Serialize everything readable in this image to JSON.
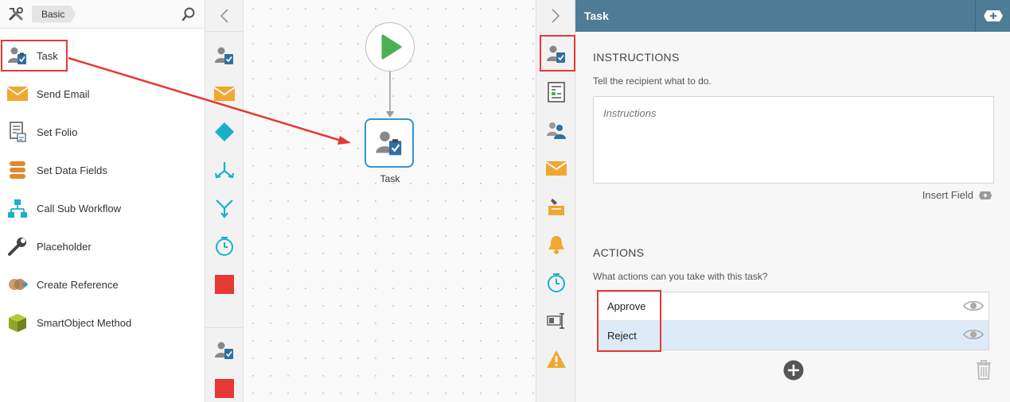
{
  "toolbox": {
    "breadcrumb": "Basic",
    "items": [
      {
        "label": "Task",
        "icon": "task-icon"
      },
      {
        "label": "Send Email",
        "icon": "envelope-icon"
      },
      {
        "label": "Set Folio",
        "icon": "folio-icon"
      },
      {
        "label": "Set Data Fields",
        "icon": "data-fields-icon"
      },
      {
        "label": "Call Sub Workflow",
        "icon": "sub-workflow-icon"
      },
      {
        "label": "Placeholder",
        "icon": "wrench-icon"
      },
      {
        "label": "Create Reference",
        "icon": "reference-icon"
      },
      {
        "label": "SmartObject Method",
        "icon": "smartobject-icon"
      }
    ]
  },
  "canvas": {
    "task_node_label": "Task"
  },
  "properties": {
    "title": "Task",
    "instructions": {
      "heading": "INSTRUCTIONS",
      "description": "Tell the recipient what to do.",
      "placeholder": "Instructions",
      "insert_field": "Insert Field"
    },
    "actions": {
      "heading": "ACTIONS",
      "description": "What actions can you take with this task?",
      "rows": [
        "Approve",
        "Reject"
      ]
    }
  },
  "colors": {
    "header": "#4e7b95",
    "start_green": "#4caf50",
    "node_border": "#2f95d6",
    "highlight": "#e53935",
    "cyan": "#1ab0c8",
    "orange": "#f0a830",
    "red": "#e53935"
  }
}
